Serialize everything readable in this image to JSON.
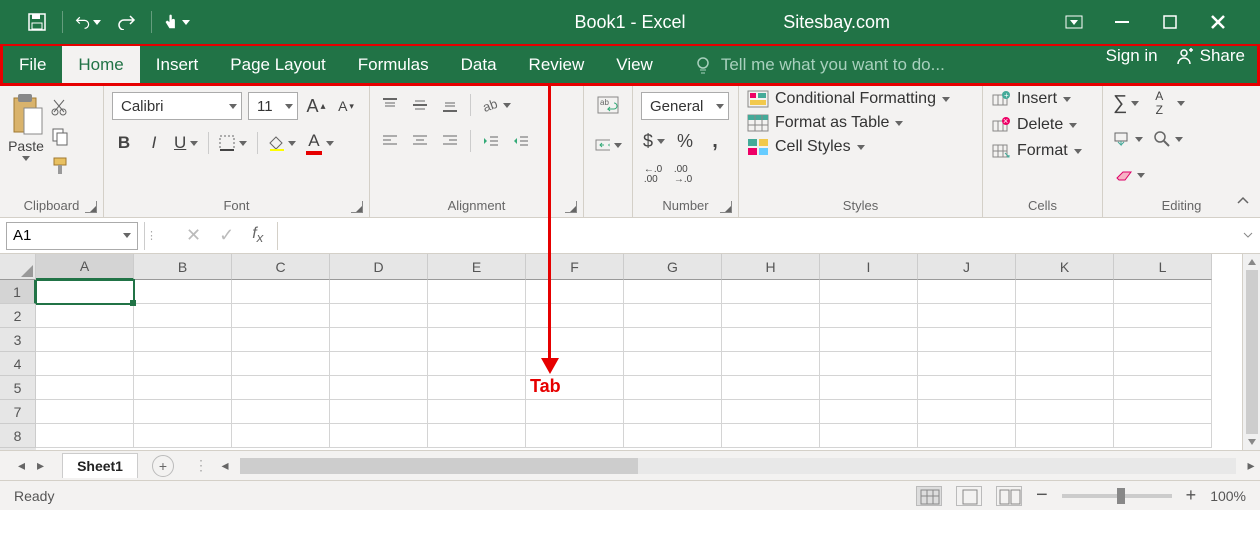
{
  "title": "Book1 - Excel",
  "site": "Sitesbay.com",
  "tabs": [
    "File",
    "Home",
    "Insert",
    "Page Layout",
    "Formulas",
    "Data",
    "Review",
    "View"
  ],
  "tell_me": "Tell me what you want to do...",
  "signin": "Sign in",
  "share": "Share",
  "groups": {
    "clipboard": "Clipboard",
    "font": "Font",
    "alignment": "Alignment",
    "number": "Number",
    "styles": "Styles",
    "cells": "Cells",
    "editing": "Editing"
  },
  "paste": "Paste",
  "font_name": "Calibri",
  "font_size": "11",
  "number_format": "General",
  "styles_items": {
    "cond": "Conditional Formatting",
    "table": "Format as Table",
    "cell": "Cell Styles"
  },
  "cells_items": {
    "insert": "Insert",
    "delete": "Delete",
    "format": "Format"
  },
  "namebox": "A1",
  "columns": [
    "A",
    "B",
    "C",
    "D",
    "E",
    "F",
    "G",
    "H",
    "I",
    "J",
    "K",
    "L"
  ],
  "rows": [
    "1",
    "2",
    "3",
    "4",
    "5",
    "7",
    "8"
  ],
  "sheet": "Sheet1",
  "status": "Ready",
  "zoom": "100%",
  "annotation": "Tab"
}
